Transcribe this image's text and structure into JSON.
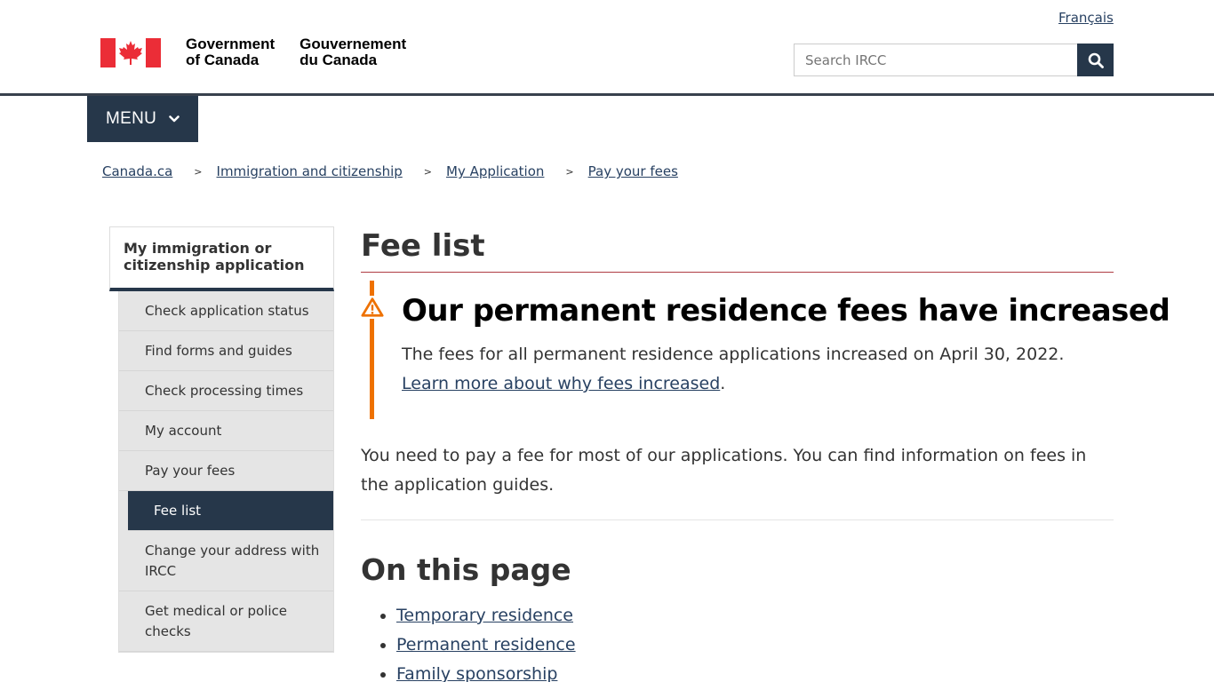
{
  "header": {
    "language_link": "Français",
    "wordmark_en": [
      "Government",
      "of Canada"
    ],
    "wordmark_fr": [
      "Gouvernement",
      "du Canada"
    ],
    "search_placeholder": "Search IRCC",
    "menu_label": "MENU"
  },
  "breadcrumb": [
    "Canada.ca",
    "Immigration and citizenship",
    "My Application",
    "Pay your fees"
  ],
  "sidebar": {
    "heading": "My immigration or citizenship application",
    "items": [
      {
        "label": "Check application status"
      },
      {
        "label": "Find forms and guides"
      },
      {
        "label": "Check processing times"
      },
      {
        "label": "My account"
      },
      {
        "label": "Pay your fees"
      },
      {
        "label": "Fee list"
      },
      {
        "label": "Change your address with IRCC"
      },
      {
        "label": "Get medical or police checks"
      }
    ]
  },
  "main": {
    "title": "Fee list",
    "alert": {
      "heading": "Our permanent residence fees have increased",
      "text": "The fees for all permanent residence applications increased on April 30, 2022. ",
      "link": "Learn more about why fees increased",
      "after": "."
    },
    "intro": "You need to pay a fee for most of our applications. You can find information on fees in the application guides.",
    "toc_title": "On this page",
    "toc": [
      "Temporary residence",
      "Permanent residence",
      "Family sponsorship"
    ]
  },
  "colors": {
    "primary": "#26374a",
    "link": "#284162",
    "flag_red": "#eb2d37",
    "alert_orange": "#ee7100",
    "title_rule": "#af3c43"
  }
}
